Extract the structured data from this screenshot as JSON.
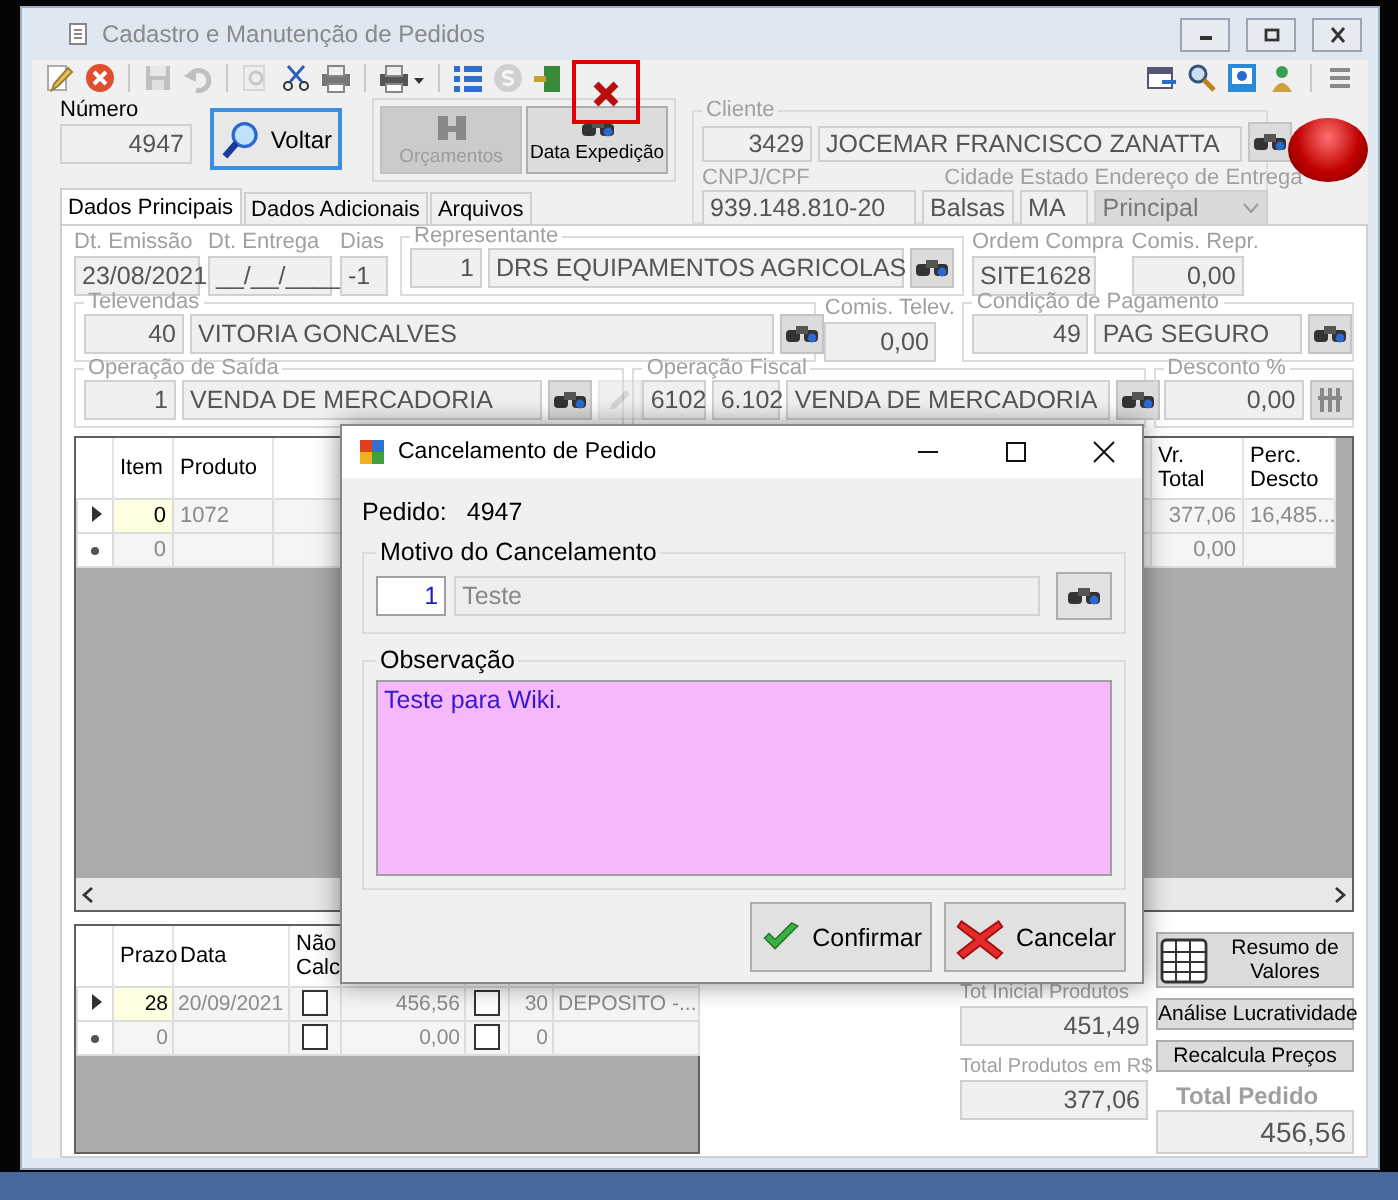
{
  "window": {
    "title": "Cadastro e Manutenção de Pedidos"
  },
  "toolbar": {
    "left": [
      {
        "kind": "edit",
        "disabled": false,
        "highlighted": false
      },
      {
        "kind": "cancel",
        "disabled": false,
        "highlighted": false
      },
      {
        "kind": "save",
        "disabled": true,
        "highlighted": false
      },
      {
        "kind": "undo",
        "disabled": true,
        "highlighted": false
      },
      {
        "kind": "find",
        "disabled": true,
        "highlighted": false
      },
      {
        "kind": "tools",
        "disabled": false,
        "highlighted": false
      },
      {
        "kind": "print",
        "disabled": false,
        "highlighted": false
      },
      {
        "kind": "print-menu",
        "disabled": false,
        "highlighted": false
      },
      {
        "kind": "list",
        "disabled": false,
        "highlighted": false
      },
      {
        "kind": "coin",
        "disabled": true,
        "highlighted": false
      },
      {
        "kind": "exit",
        "disabled": false,
        "highlighted": false
      },
      {
        "kind": "delete",
        "disabled": false,
        "highlighted": true
      }
    ],
    "right": [
      {
        "kind": "window"
      },
      {
        "kind": "search"
      },
      {
        "kind": "monitor"
      },
      {
        "kind": "person"
      },
      {
        "kind": "menu"
      }
    ]
  },
  "header": {
    "number_label": "Número",
    "number": "4947",
    "back_button": "Voltar",
    "buttons": [
      {
        "label": "Orçamentos",
        "kind": "quotes",
        "disabled": true
      },
      {
        "label": "Data Expedição",
        "kind": "shipping",
        "disabled": false
      }
    ]
  },
  "client": {
    "label": "Cliente",
    "code": "3429",
    "name": "JOCEMAR FRANCISCO ZANATTA",
    "document_label": "CNPJ/CPF",
    "document": "939.148.810-20",
    "city_label": "Cidade",
    "city": "Balsas",
    "state_label": "Estado",
    "state": "MA",
    "address_label": "Endereço de Entrega",
    "address": "Principal"
  },
  "tabs": [
    {
      "label": "Dados Principais",
      "selected": true
    },
    {
      "label": "Dados Adicionais",
      "selected": false
    },
    {
      "label": "Arquivos",
      "selected": false
    }
  ],
  "main": {
    "issue_label": "Dt. Emissão",
    "issue": "23/08/2021",
    "delivery_label": "Dt. Entrega",
    "delivery": "__/__/____",
    "days_label": "Dias",
    "days": "-1",
    "rep_label": "Representante",
    "rep_code": "1",
    "rep_name": "DRS EQUIPAMENTOS AGRICOLAS",
    "po_label": "Ordem Compra",
    "po": "SITE1628",
    "rep_comm_label": "Comis. Repr.",
    "rep_comm": "0,00",
    "tele_label": "Televendas",
    "tele_code": "40",
    "tele_name": "VITORIA GONCALVES",
    "tele_comm_label": "Comis. Telev.",
    "tele_comm": "0,00",
    "pay_label": "Condição de Pagamento",
    "pay_code": "49",
    "pay_name": "PAG SEGURO",
    "out_label": "Operação de Saída",
    "out_code": "1",
    "out_name": "VENDA DE MERCADORIA",
    "out_edit_disabled": true,
    "fiscal_label": "Operação Fiscal",
    "fiscal_code": "6102",
    "fiscal_cfop": "6.102",
    "fiscal_name": "VENDA DE MERCADORIA",
    "discount_label": "Desconto %",
    "discount": "0,00"
  },
  "items": {
    "columns": [
      {
        "label": "Item"
      },
      {
        "label": "Produto"
      },
      {
        "label": "Vr. Total"
      },
      {
        "label": "Perc. Descto"
      }
    ],
    "rows": [
      {
        "kind": "current",
        "item": "0",
        "product": "1072",
        "total": "377,06",
        "discount": "16,485..."
      },
      {
        "kind": "new",
        "item": "0",
        "total": "0,00"
      }
    ]
  },
  "installments": {
    "columns": [
      {
        "label": "Prazo"
      },
      {
        "label": "Data"
      },
      {
        "label": "Não Calc"
      }
    ],
    "rows": [
      {
        "kind": "current",
        "term": "28",
        "date": "20/09/2021",
        "no_calc": false,
        "value": "456,56",
        "flag": false,
        "code": "30",
        "description": "DEPOSITO -..."
      },
      {
        "kind": "new",
        "term": "0",
        "no_calc": false,
        "value": "0,00",
        "flag": false,
        "code": "0"
      }
    ]
  },
  "totals": {
    "initial_label": "Tot Inicial Produtos",
    "initial": "451,49",
    "products_label": "Total Produtos em R$",
    "products": "377,06",
    "order_label": "Total Pedido",
    "order": "456,56",
    "buttons": [
      "Resumo de Valores",
      "Análise Lucratividade",
      "Recalcula Preços"
    ]
  },
  "dialog": {
    "title": "Cancelamento de Pedido",
    "order_label": "Pedido:",
    "order": "4947",
    "reason": {
      "label": "Motivo do Cancelamento",
      "code": "1",
      "description": "Teste"
    },
    "note": {
      "label": "Observação",
      "value": "Teste para Wiki."
    },
    "buttons": [
      {
        "label": "Confirmar",
        "kind": "confirm"
      },
      {
        "label": "Cancelar",
        "kind": "cancel"
      }
    ]
  }
}
